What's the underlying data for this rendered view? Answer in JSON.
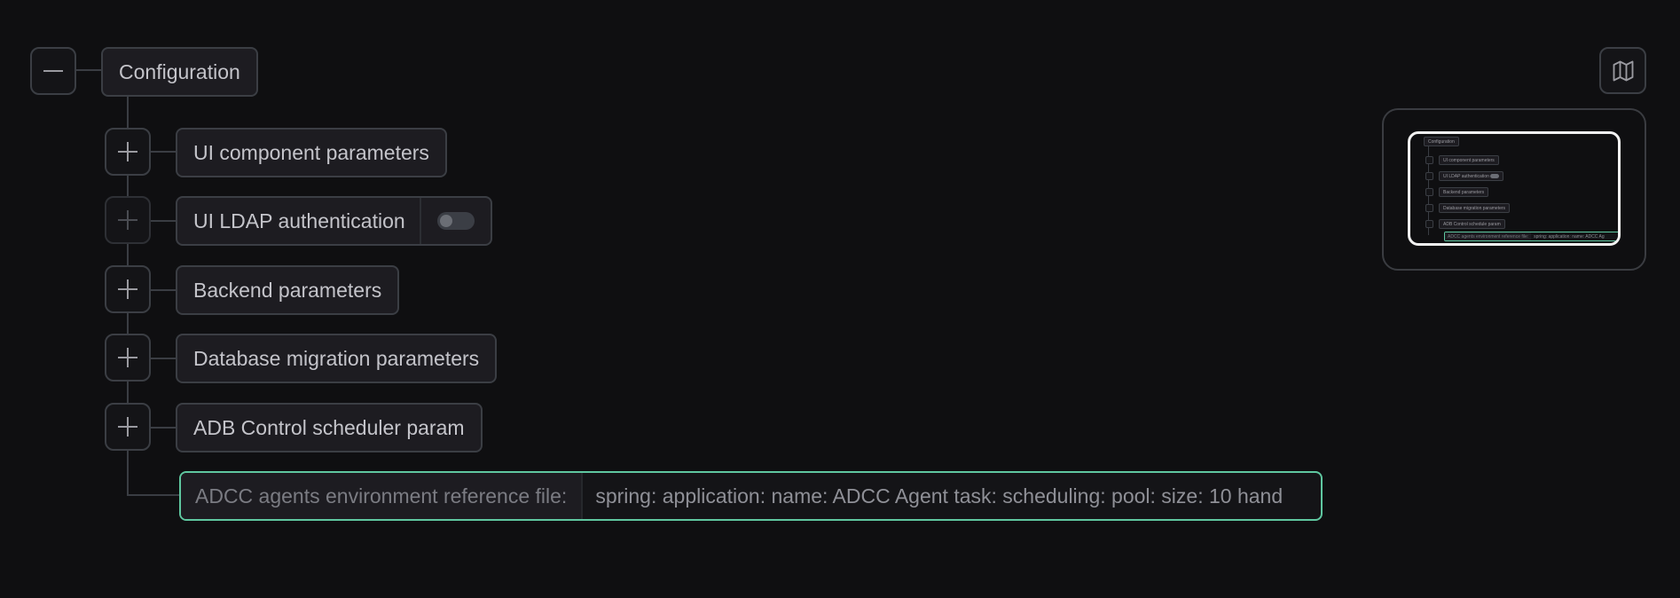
{
  "tree": {
    "root": {
      "label": "Configuration",
      "expanded": true
    },
    "children": [
      {
        "label": "UI component parameters",
        "expanded": false
      },
      {
        "label": "UI LDAP authentication",
        "expanded": false,
        "toggle_enabled": false,
        "disabled": true
      },
      {
        "label": "Backend parameters",
        "expanded": false
      },
      {
        "label": "Database migration parameters",
        "expanded": false
      },
      {
        "label": "ADB Control scheduler param",
        "expanded": false
      }
    ],
    "selected_leaf": {
      "label": "ADCC agents environment reference file:",
      "value": "spring: application: name: ADCC Agent task: scheduling: pool: size: 10 hand"
    }
  },
  "minimap": {
    "root_label": "Configuration",
    "items": [
      "UI component parameters",
      "UI LDAP authentication",
      "Backend parameters",
      "Database migration parameters",
      "ADB Control schedule param"
    ],
    "leaf_label": "ADCC agents environment reference file:",
    "leaf_value": "spring: application: name: ADCC Ag"
  },
  "icons": {
    "collapse": "minus-icon",
    "expand": "plus-icon",
    "map": "map-icon"
  },
  "colors": {
    "background": "#0f0f11",
    "border": "#3b3e44",
    "selected_border": "#5fc7a0",
    "text": "#c4c4ca"
  }
}
